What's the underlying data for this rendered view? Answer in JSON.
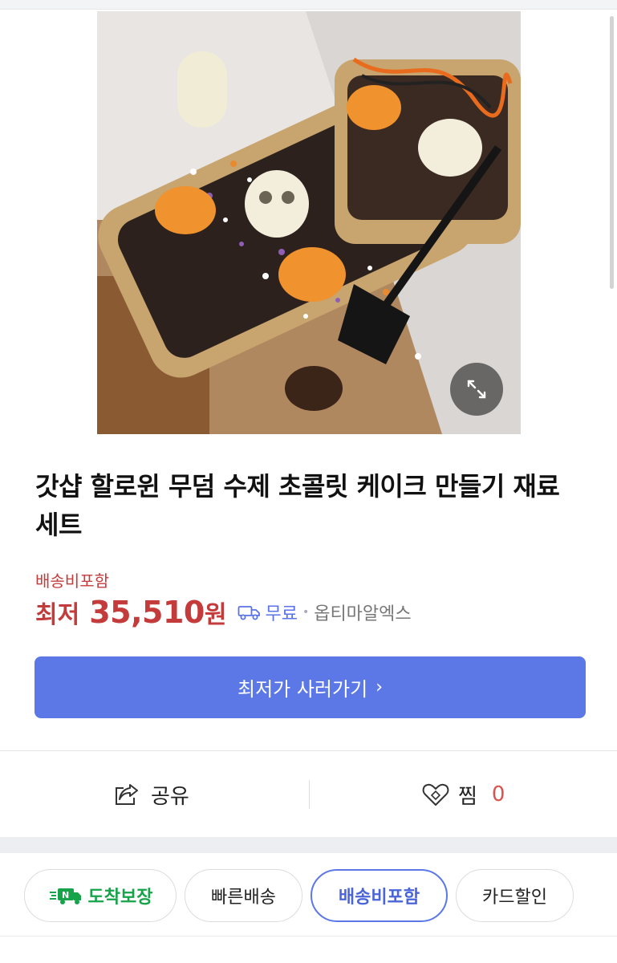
{
  "product": {
    "title": "갓샵 할로윈 무덤 수제 초콜릿 케이크 만들기 재료 세트",
    "shipping_included_label": "배송비포함",
    "price_prefix": "최저",
    "price": "35,510",
    "price_unit": "원",
    "delivery_fee": "무료",
    "store": "옵티마알엑스"
  },
  "buy_button": {
    "label": "최저가 사러가기",
    "chevron": "›"
  },
  "actions": {
    "share_label": "공유",
    "wishlist_label": "찜",
    "wishlist_count": "0"
  },
  "filters": [
    {
      "label": "도착보장",
      "badge_icon": "n-delivery-truck-icon",
      "active": false
    },
    {
      "label": "빠른배송",
      "active": false
    },
    {
      "label": "배송비포함",
      "active": true
    },
    {
      "label": "카드할인",
      "active": false
    }
  ],
  "colors": {
    "price_red": "#c43b3b",
    "accent_blue": "#5b78e6",
    "badge_green": "#16a34a"
  }
}
